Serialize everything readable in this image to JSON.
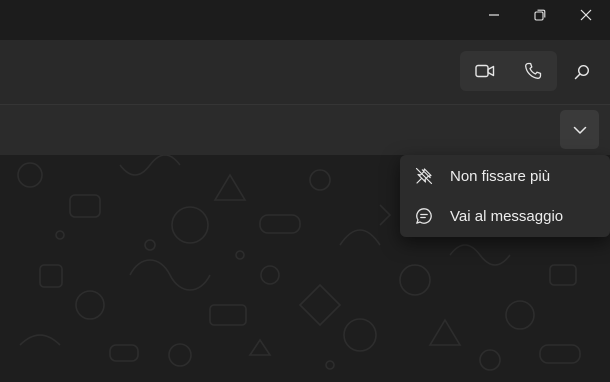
{
  "window_controls": {
    "minimize_icon": "minimize-icon",
    "restore_icon": "restore-icon",
    "close_icon": "close-icon"
  },
  "header": {
    "video_call_icon": "video-camera-icon",
    "voice_call_icon": "phone-icon",
    "search_icon": "search-icon"
  },
  "pinned_bar": {
    "expand_icon": "chevron-down-icon"
  },
  "context_menu": {
    "items": [
      {
        "label": "Non fissare più",
        "icon": "unpin-icon"
      },
      {
        "label": "Vai al messaggio",
        "icon": "message-bubble-icon"
      }
    ]
  },
  "colors": {
    "titlebar": "#1c1c1c",
    "header": "#292929",
    "chat_background": "#1e1e1e",
    "menu": "#2c2c2c",
    "text": "#ededed"
  }
}
